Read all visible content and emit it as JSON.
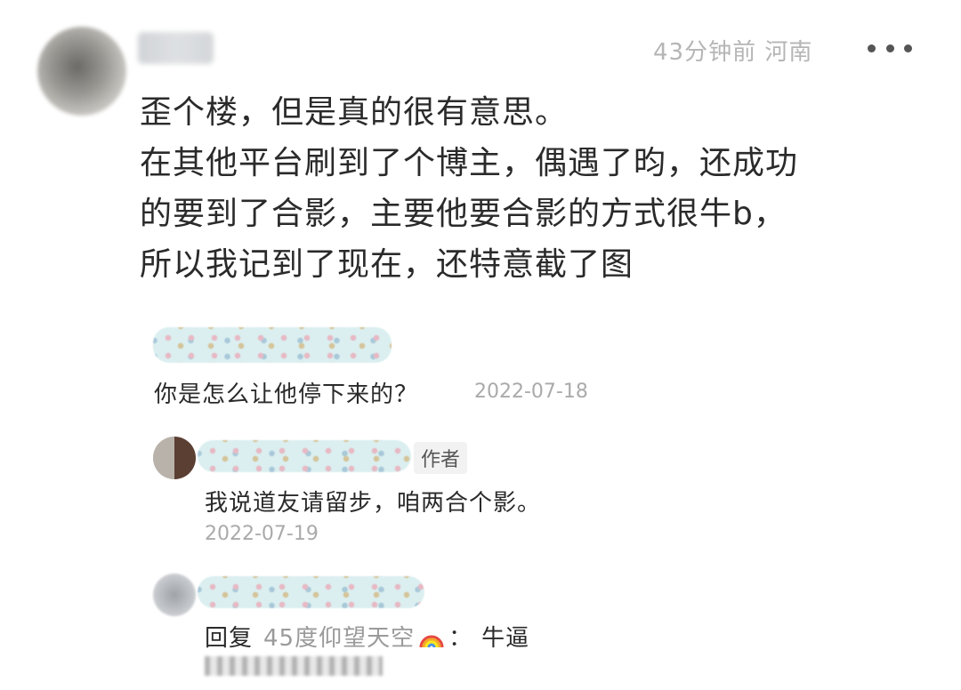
{
  "post": {
    "meta": "43分钟前 河南",
    "body_lines": [
      "歪个楼，但是真的很有意思。",
      "在其他平台刷到了个博主，偶遇了昀，还成功",
      "的要到了合影，主要他要合影的方式很牛b，",
      "所以我记到了现在，还特意截了图"
    ]
  },
  "replies": [
    {
      "text": "你是怎么让他停下来的？",
      "date": "2022-07-18"
    },
    {
      "badge": "作者",
      "text": "我说道友请留步，咱两合个影。",
      "date": "2022-07-19"
    },
    {
      "prefix": "回复",
      "mention": "45度仰望天空",
      "separator": "：",
      "text": "牛逼"
    }
  ],
  "icons": {
    "more": "more-icon",
    "rainbow": "rainbow-icon"
  }
}
